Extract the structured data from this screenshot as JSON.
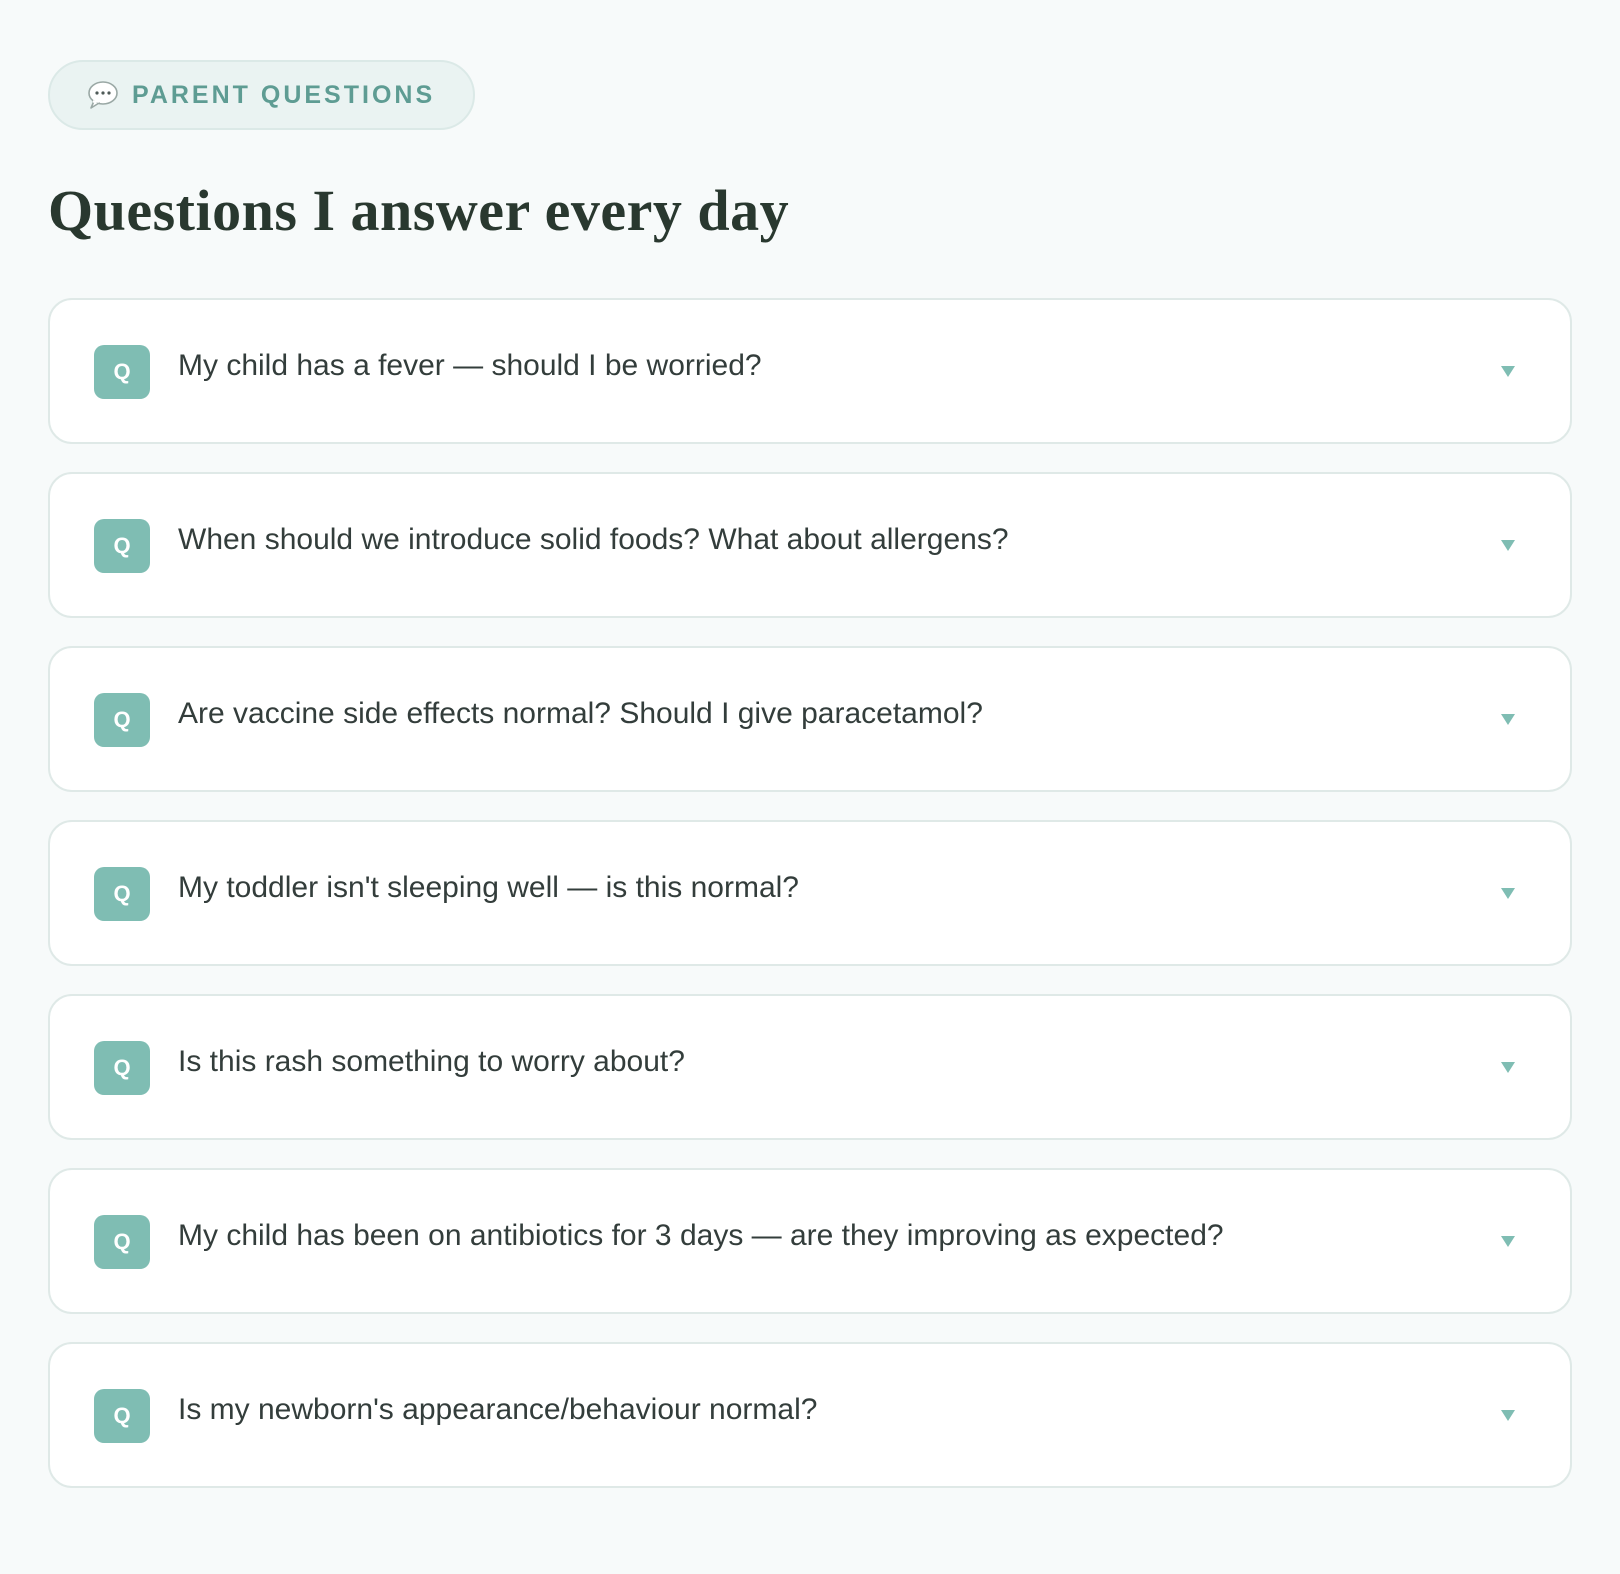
{
  "section": {
    "badge_label": "PARENT QUESTIONS",
    "badge_icon": "speech-bubble-icon",
    "title": "Questions I answer every day"
  },
  "faq": {
    "badge_letter": "Q",
    "expand_icon": "chevron-down-icon",
    "items": [
      {
        "question": "My child has a fever — should I be worried?"
      },
      {
        "question": "When should we introduce solid foods? What about allergens?"
      },
      {
        "question": "Are vaccine side effects normal? Should I give paracetamol?"
      },
      {
        "question": "My toddler isn't sleeping well — is this normal?"
      },
      {
        "question": "Is this rash something to worry about?"
      },
      {
        "question": "My child has been on antibiotics for 3 days — are they improving as expected?"
      },
      {
        "question": "Is my newborn's appearance/behaviour normal?"
      }
    ]
  },
  "colors": {
    "accent": "#7fbdb3",
    "accent_text": "#5e9c93",
    "background": "#f7fafa",
    "card_border": "#dfe9e7"
  }
}
